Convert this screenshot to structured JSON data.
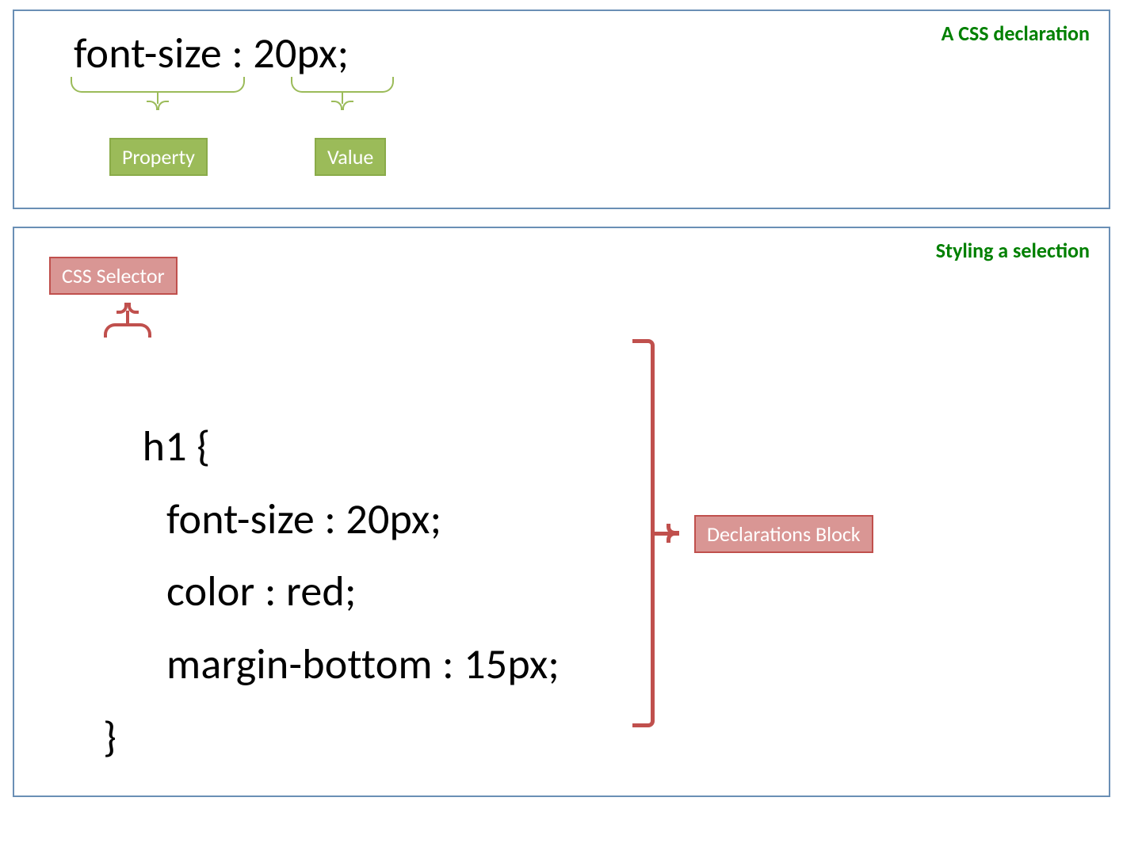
{
  "panel1": {
    "title": "A CSS declaration",
    "declaration": "font-size : 20px;",
    "property_label": "Property",
    "value_label": "Value",
    "property_text": "font-size",
    "value_text": "20px"
  },
  "panel2": {
    "title": "Styling a selection",
    "selector_label": "CSS Selector",
    "block_label": "Declarations Block",
    "selector": "h1",
    "open_brace": "{",
    "close_brace": "}",
    "declarations": [
      "font-size : 20px;",
      "color : red;",
      "margin-bottom : 15px;"
    ]
  }
}
